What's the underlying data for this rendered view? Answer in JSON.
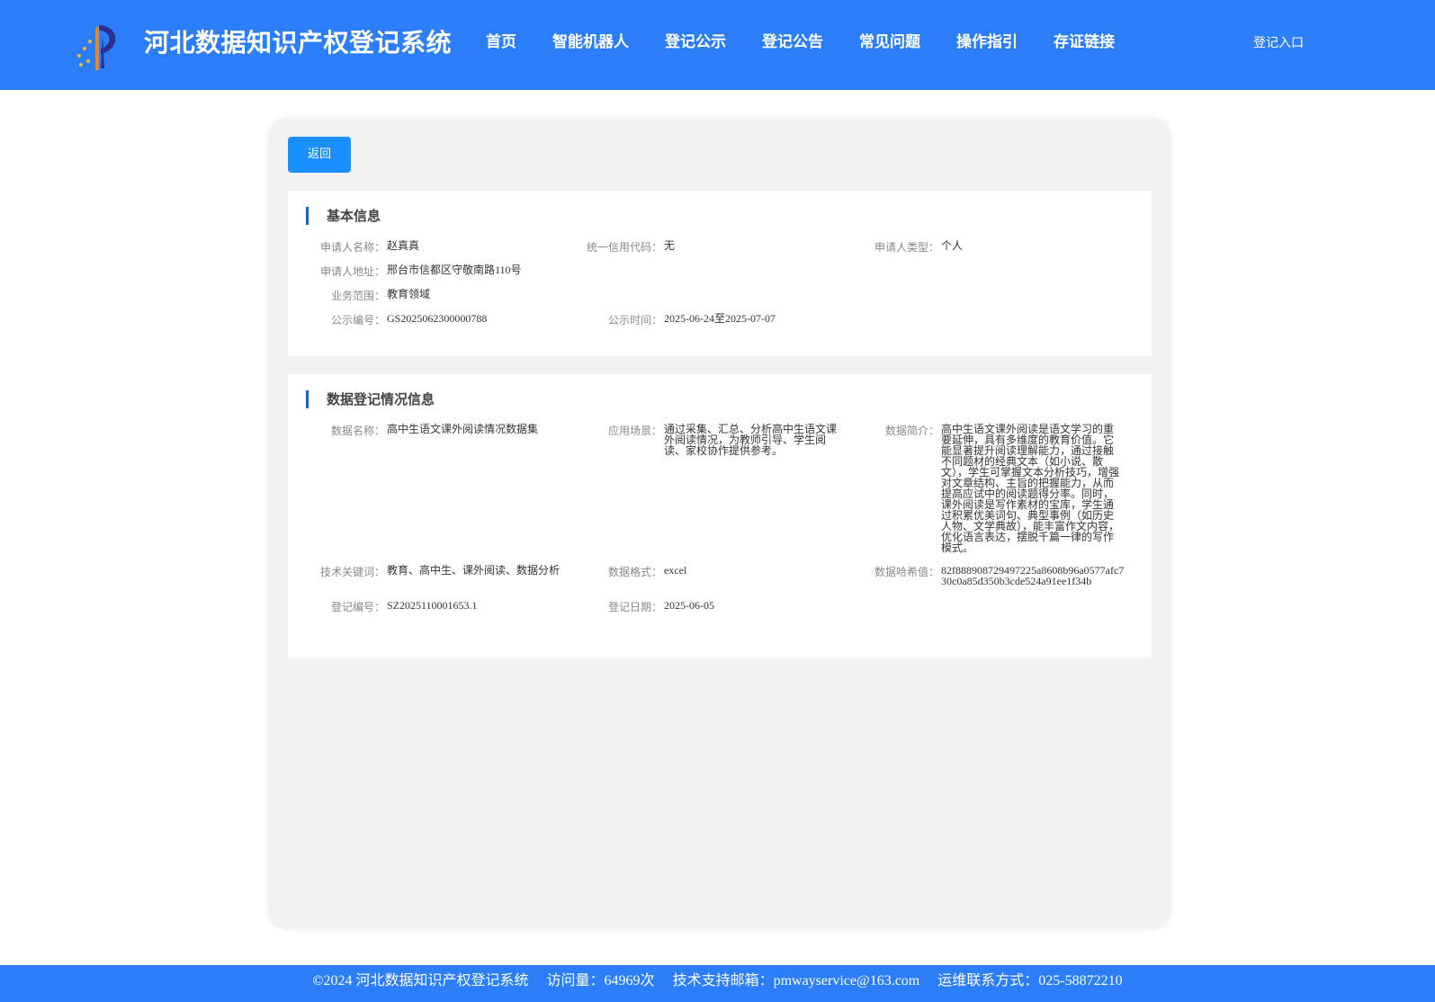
{
  "header": {
    "site_title": "河北数据知识产权登记系统",
    "nav": [
      "首页",
      "智能机器人",
      "登记公示",
      "登记公告",
      "常见问题",
      "操作指引",
      "存证链接"
    ],
    "login_label": "登记入口",
    "logo_icon": "hebei-ip-logo-icon",
    "bg_color": "#2b7ef7"
  },
  "actions": {
    "back_label": "返回",
    "back_color": "#1890ff"
  },
  "basic": {
    "title": "基本信息",
    "applicant_name_label": "申请人名称：",
    "applicant_name": "赵真真",
    "credit_code_label": "统一信用代码：",
    "credit_code": "无",
    "applicant_type_label": "申请人类型：",
    "applicant_type": "个人",
    "address_label": "申请人地址：",
    "address": "邢台市信都区守敬南路110号",
    "scope_label": "业务范围：",
    "scope": "教育领域",
    "notice_no_label": "公示编号：",
    "notice_no": "GS2025062300000788",
    "notice_time_label": "公示时间：",
    "notice_time": "2025-06-24至2025-07-07"
  },
  "registration": {
    "title": "数据登记情况信息",
    "data_name_label": "数据名称：",
    "data_name": "高中生语文课外阅读情况数据集",
    "scenario_label": "应用场景：",
    "scenario": "通过采集、汇总、分析高中生语文课外阅读情况，为教师引导、学生阅读、家校协作提供参考。",
    "intro_label": "数据简介：",
    "intro": "高中生语文课外阅读是语文学习的重要延伸，具有多维度的教育价值。它能显著提升阅读理解能力，通过接触不同题材的经典文本（如小说、散文），学生可掌握文本分析技巧，增强对文章结构、主旨的把握能力，从而提高应试中的阅读题得分率。同时，课外阅读是写作素材的宝库，学生通过积累优美词句、典型事例（如历史人物、文学典故），能丰富作文内容，优化语言表达，摆脱千篇一律的写作模式。",
    "keywords_label": "技术关键词：",
    "keywords": "教育、高中生、课外阅读、数据分析",
    "format_label": "数据格式：",
    "format": "excel",
    "hash_label": "数据哈希值：",
    "hash": "82f888908729497225a8608b96a0577afc730c0a85d350b3cde524a91ee1f34b",
    "reg_no_label": "登记编号：",
    "reg_no": "SZ2025110001653.1",
    "reg_date_label": "登记日期：",
    "reg_date": "2025-06-05"
  },
  "footer": {
    "copyright": "©2024 河北数据知识产权登记系统",
    "visits": "访问量：64969次",
    "support": "技术支持邮箱：pmwayservice@163.com",
    "ops": "运维联系方式：025-58872210"
  }
}
